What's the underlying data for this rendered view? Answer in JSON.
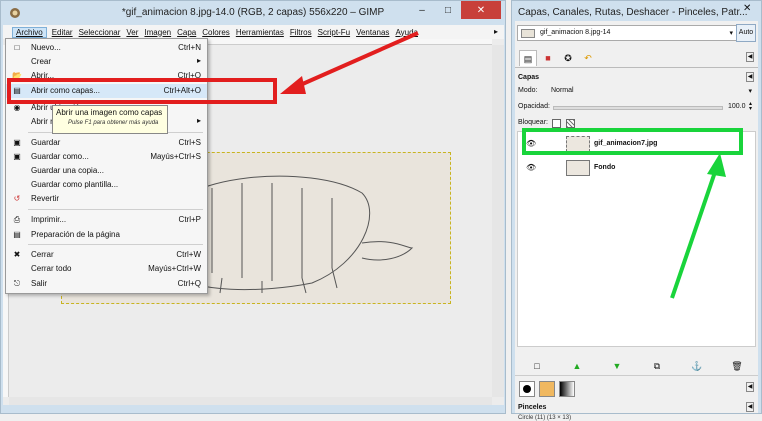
{
  "main_window": {
    "title": "*gif_animacion 8.jpg-14.0 (RGB, 2 capas) 556x220 – GIMP",
    "menubar": [
      "Archivo",
      "Editar",
      "Seleccionar",
      "Ver",
      "Imagen",
      "Capa",
      "Colores",
      "Herramientas",
      "Filtros",
      "Script-Fu",
      "Ventanas",
      "Ayuda"
    ]
  },
  "file_menu": {
    "items": [
      {
        "label": "Nuevo...",
        "shortcut": "Ctrl+N",
        "icon": "new-document-icon"
      },
      {
        "label": "Crear",
        "shortcut": "",
        "icon": ""
      },
      {
        "label": "Abrir...",
        "shortcut": "Ctrl+O",
        "icon": "open-icon"
      },
      {
        "label": "Abrir como capas...",
        "shortcut": "Ctrl+Alt+O",
        "icon": "open-as-layers-icon"
      },
      {
        "label": "Abrir ubicación...",
        "shortcut": "",
        "icon": "open-location-icon"
      },
      {
        "label": "Abrir reciente",
        "shortcut": "",
        "icon": ""
      },
      {
        "label": "Guardar",
        "shortcut": "Ctrl+S",
        "icon": "save-icon"
      },
      {
        "label": "Guardar como...",
        "shortcut": "Mayús+Ctrl+S",
        "icon": "save-as-icon"
      },
      {
        "label": "Guardar una copia...",
        "shortcut": "",
        "icon": ""
      },
      {
        "label": "Guardar como plantilla...",
        "shortcut": "",
        "icon": ""
      },
      {
        "label": "Revertir",
        "shortcut": "",
        "icon": "revert-icon"
      },
      {
        "label": "Imprimir...",
        "shortcut": "Ctrl+P",
        "icon": "print-icon"
      },
      {
        "label": "Preparación de la página",
        "shortcut": "",
        "icon": "page-setup-icon"
      },
      {
        "label": "Cerrar",
        "shortcut": "Ctrl+W",
        "icon": "close-icon"
      },
      {
        "label": "Cerrar todo",
        "shortcut": "Mayús+Ctrl+W",
        "icon": ""
      },
      {
        "label": "Salir",
        "shortcut": "Ctrl+Q",
        "icon": "quit-icon"
      }
    ],
    "tooltip": {
      "text": "Abrir una imagen como capas",
      "help": "Pulse F1 para obtener más ayuda"
    }
  },
  "dock": {
    "title": "Capas, Canales, Rutas, Deshacer - Pinceles, Patr...",
    "image_selector": "gif_animacion 8.jpg-14",
    "auto_label": "Auto",
    "layers_panel": {
      "title": "Capas",
      "mode_label": "Modo:",
      "mode_value": "Normal",
      "opacity_label": "Opacidad:",
      "opacity_value": "100.0",
      "lock_label": "Bloquear:",
      "layers": [
        {
          "name": "gif_animacion7.jpg",
          "visible": true,
          "selected": true
        },
        {
          "name": "Fondo",
          "visible": true,
          "selected": false
        }
      ]
    },
    "brushes_panel": {
      "title": "Pinceles",
      "brush_info": "Circle (11) (13 × 13)"
    }
  },
  "annotations": {
    "red_color": "#e21e1e",
    "green_color": "#19d43b"
  }
}
